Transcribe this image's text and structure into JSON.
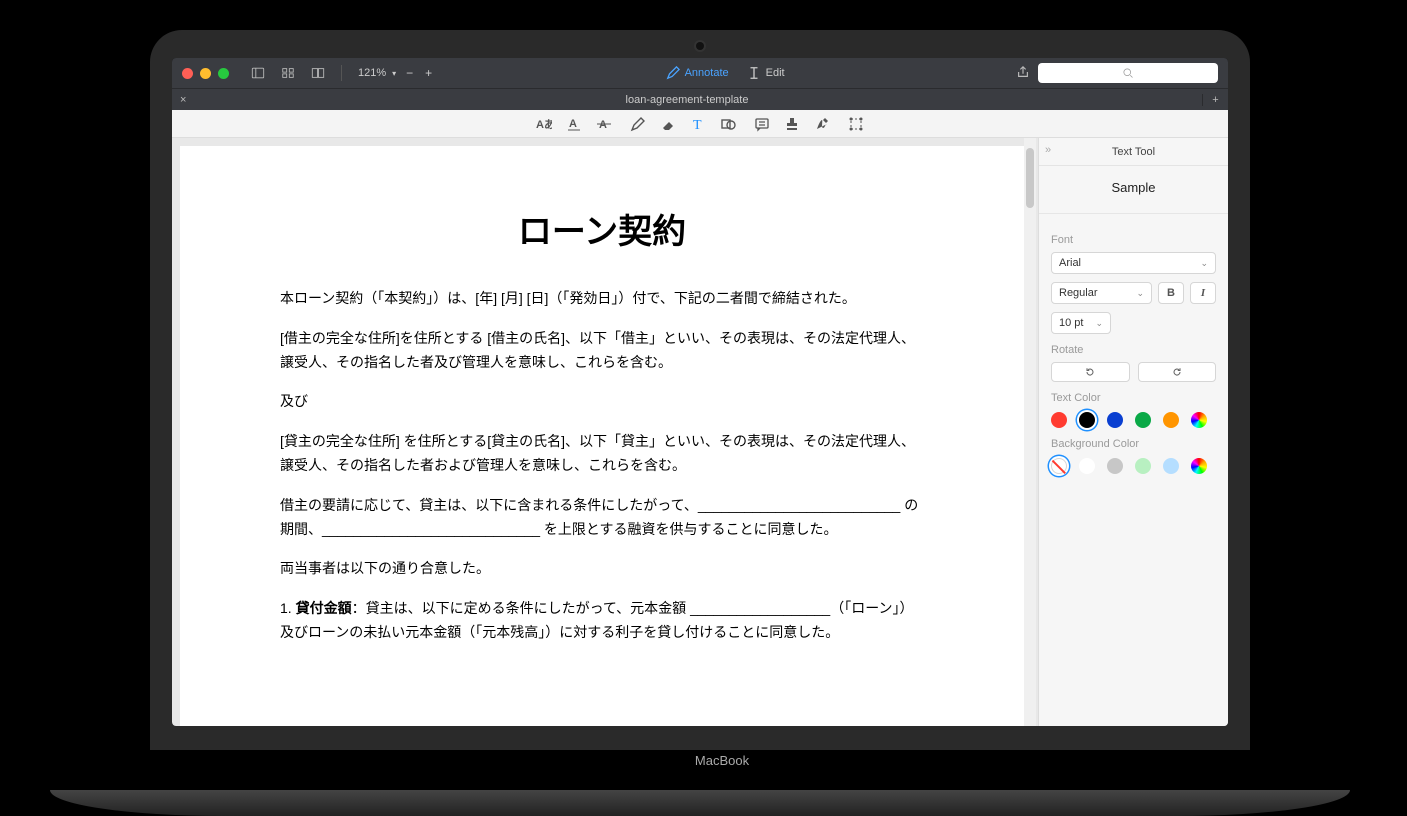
{
  "laptop_label": "MacBook",
  "zoom": "121%",
  "modes": {
    "annotate": "Annotate",
    "edit": "Edit"
  },
  "tab_title": "loan-agreement-template",
  "document": {
    "title": "ローン契約",
    "p1": "本ローン契約（「本契約」）は、[年] [月] [日]（「発効日」）付で、下記の二者間で締結された。",
    "p2": "[借主の完全な住所]を住所とする [借主の氏名]、以下「借主」といい、その表現は、その法定代理人、譲受人、その指名した者及び管理人を意味し、これらを含む。",
    "p3": "及び",
    "p4": "[貸主の完全な住所] を住所とする[貸主の氏名]、以下「貸主」といい、その表現は、その法定代理人、譲受人、その指名した者および管理人を意味し、これらを含む。",
    "p5": "借主の要請に応じて、貸主は、以下に含まれる条件にしたがって、__________________________ の期間、____________________________ を上限とする融資を供与することに同意した。",
    "p6": "両当事者は以下の通り合意した。",
    "p7_label": "貸付金額",
    "p7_rest": "：貸主は、以下に定める条件にしたがって、元本金額 __________________（「ローン」）及びローンの未払い元本金額（「元本残高」）に対する利子を貸し付けることに同意した。"
  },
  "panel": {
    "title": "Text Tool",
    "sample": "Sample",
    "font_label": "Font",
    "font_value": "Arial",
    "weight_value": "Regular",
    "bold": "B",
    "italic": "I",
    "size_value": "10 pt",
    "rotate_label": "Rotate",
    "textcolor_label": "Text Color",
    "bgcolor_label": "Background Color"
  },
  "text_colors": [
    "#ff3b30",
    "#000000",
    "#0a3fd1",
    "#0aa947",
    "#ff9500",
    "rainbow"
  ],
  "bg_colors": [
    "none",
    "#ffffff",
    "#c7c7c7",
    "#b8f0c1",
    "#b5deff",
    "rainbow"
  ]
}
